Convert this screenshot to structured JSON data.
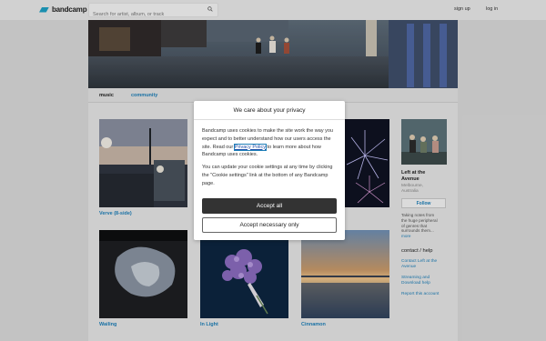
{
  "header": {
    "logo_text": "bandcamp",
    "search_placeholder": "Search for artist, album, or track",
    "signup": "sign up",
    "login": "log in"
  },
  "tabs": {
    "music": "music",
    "community": "community"
  },
  "albums": [
    {
      "title": "Verve (8-side)"
    },
    {
      "title": ""
    },
    {
      "title": ""
    },
    {
      "title": "Wailing"
    },
    {
      "title": "In Light"
    },
    {
      "title": "Cinnamon"
    }
  ],
  "sidebar": {
    "band_name_line1": "Left at the",
    "band_name_line2": "Avenue",
    "location_line1": "Melbourne,",
    "location_line2": "Australia",
    "follow": "Follow",
    "desc_line1": "Taking notes from",
    "desc_line2": "the huge peripheral",
    "desc_line3": "of genres that",
    "desc_line4": "surrounds them...",
    "more": "more",
    "contact_heading": "contact / help",
    "contact_link_line1": "Contact Left at the",
    "contact_link_line2": "Avenue",
    "streaming_line1": "Streaming and",
    "streaming_line2": "Download help",
    "report": "Report this account"
  },
  "modal": {
    "title": "We care about your privacy",
    "p1_before": "Bandcamp uses cookies to make the site work the way you expect and to better understand how our users access the site. Read our ",
    "p1_link": "Privacy Policy",
    "p1_after": " to learn more about how Bandcamp uses cookies.",
    "p2": "You can update your cookie settings at any time by clicking the \"Cookie settings\" link at the bottom of any Bandcamp page.",
    "accept_all": "Accept all",
    "accept_necessary": "Accept necessary only"
  },
  "colors": {
    "link_blue": "#1e7fb8",
    "logo_blue": "#1da0c3",
    "accept_button": "#333333"
  }
}
